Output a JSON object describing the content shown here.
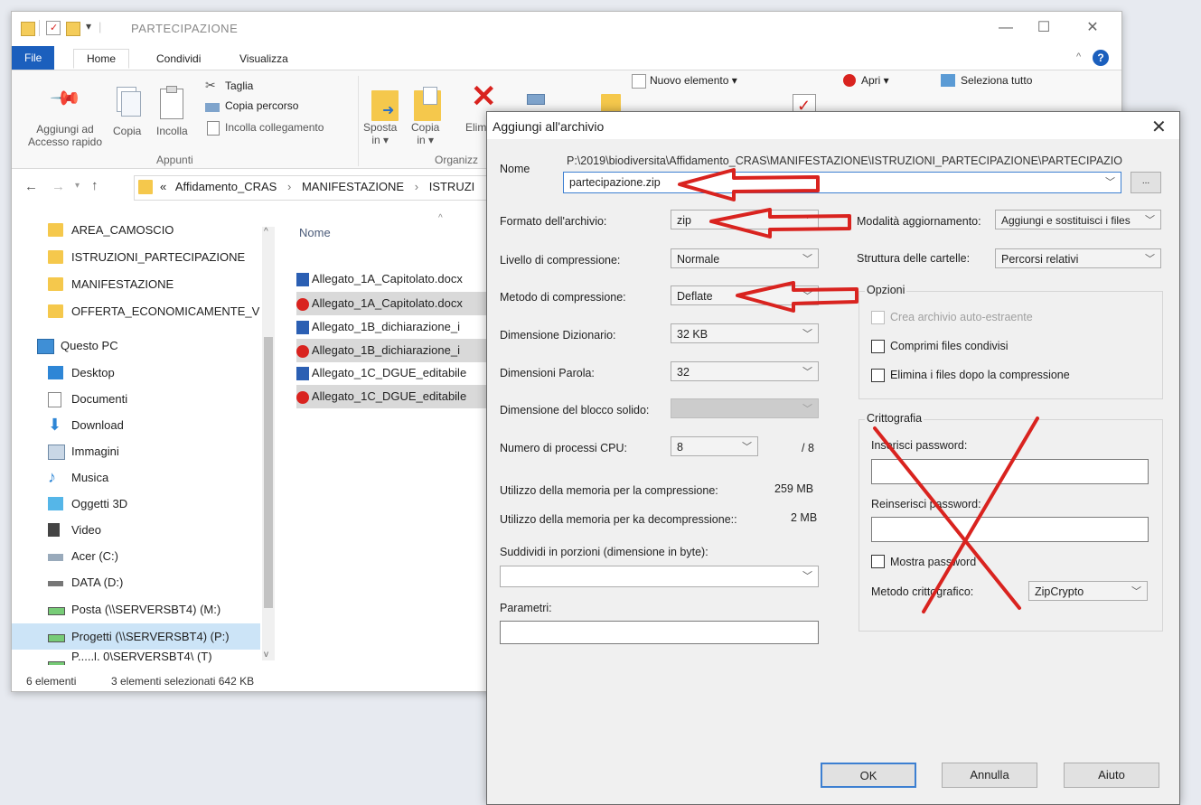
{
  "explorer": {
    "title": "PARTECIPAZIONE",
    "tabs": [
      "File",
      "Home",
      "Condividi",
      "Visualizza"
    ],
    "ribbon": {
      "pin": "Aggiungi ad Accesso rapido",
      "pin_line1": "Aggiungi ad",
      "pin_line2": "Accesso rapido",
      "copy": "Copia",
      "paste": "Incolla",
      "cut": "Taglia",
      "copy_path": "Copia percorso",
      "paste_shortcut": "Incolla collegamento",
      "clipboard_group": "Appunti",
      "move_to": "Sposta",
      "move_to_suffix": "in ▾",
      "copy_to": "Copia",
      "copy_to_suffix": "in ▾",
      "delete": "Elim",
      "organize_group": "Organizz",
      "new_item": "Nuovo elemento ▾",
      "open": "Apri ▾",
      "select_all": "Seleziona tutto"
    },
    "address": {
      "prefix": "«",
      "crumbs": [
        "Affidamento_CRAS",
        "MANIFESTAZIONE",
        "ISTRUZI"
      ],
      "sep": "›"
    },
    "nav_items": [
      {
        "label": "AREA_CAMOSCIO",
        "icon": "folder-icon"
      },
      {
        "label": "ISTRUZIONI_PARTECIPAZIONE",
        "icon": "folder-icon"
      },
      {
        "label": "MANIFESTAZIONE",
        "icon": "folder-icon"
      },
      {
        "label": "OFFERTA_ECONOMICAMENTE_V",
        "icon": "folder-icon"
      },
      {
        "label": "Questo PC",
        "icon": "pc-icon"
      },
      {
        "label": "Desktop",
        "icon": "desktop-icon"
      },
      {
        "label": "Documenti",
        "icon": "documents-icon"
      },
      {
        "label": "Download",
        "icon": "download-icon"
      },
      {
        "label": "Immagini",
        "icon": "pictures-icon"
      },
      {
        "label": "Musica",
        "icon": "music-icon"
      },
      {
        "label": "Oggetti 3D",
        "icon": "objects-3d-icon"
      },
      {
        "label": "Video",
        "icon": "video-icon"
      },
      {
        "label": "Acer (C:)",
        "icon": "drive-icon"
      },
      {
        "label": "DATA (D:)",
        "icon": "drive-icon"
      },
      {
        "label": "Posta (\\\\SERVERSBT4) (M:)",
        "icon": "network-drive-icon"
      },
      {
        "label": "Progetti (\\\\SERVERSBT4) (P:)",
        "icon": "network-drive-icon"
      },
      {
        "label": "P.....l. 0\\SERVERSBT4\\ (T)",
        "icon": "network-drive-icon"
      }
    ],
    "column_header": "Nome",
    "files": [
      {
        "name": "Allegato_1A_Capitolato.docx",
        "type": "word"
      },
      {
        "name": "Allegato_1A_Capitolato.docx",
        "type": "pdf"
      },
      {
        "name": "Allegato_1B_dichiarazione_i",
        "type": "word"
      },
      {
        "name": "Allegato_1B_dichiarazione_i",
        "type": "pdf"
      },
      {
        "name": "Allegato_1C_DGUE_editabile",
        "type": "word"
      },
      {
        "name": "Allegato_1C_DGUE_editabile",
        "type": "pdf"
      }
    ],
    "status": {
      "count": "6 elementi",
      "selected": "3 elementi selezionati  642 KB"
    }
  },
  "dialog": {
    "title": "Aggiungi all'archivio",
    "name_label": "Nome",
    "path": "P:\\2019\\biodiversita\\Affidamento_CRAS\\MANIFESTAZIONE\\ISTRUZIONI_PARTECIPAZIONE\\PARTECIPAZIO",
    "filename": "partecipazione.zip",
    "browse": "...",
    "format_label": "Formato dell'archivio:",
    "format_value": "zip",
    "level_label": "Livello di compressione:",
    "level_value": "Normale",
    "method_label": "Metodo di compressione:",
    "method_value": "Deflate",
    "dict_label": "Dimensione Dizionario:",
    "dict_value": "32 KB",
    "word_label": "Dimensioni Parola:",
    "word_value": "32",
    "solid_label": "Dimensione del blocco solido:",
    "cpu_label": "Numero di processi CPU:",
    "cpu_value": "8",
    "cpu_total": "/ 8",
    "mem_comp_label": "Utilizzo della memoria per la compressione:",
    "mem_comp_value": "259 MB",
    "mem_decomp_label": "Utilizzo della memoria per ka decompressione::",
    "mem_decomp_value": "2 MB",
    "split_label": "Suddividi in porzioni (dimensione in byte):",
    "params_label": "Parametri:",
    "update_label": "Modalità aggiornamento:",
    "update_value": "Aggiungi e sostituisci i files",
    "paths_label": "Struttura delle cartelle:",
    "paths_value": "Percorsi relativi",
    "options_legend": "Opzioni",
    "opt_sfx": "Crea archivio auto-estraente",
    "opt_shared": "Comprimi files condivisi",
    "opt_delete": "Elimina i files dopo la compressione",
    "crypto_legend": "Crittografia",
    "pwd_label": "Inserisci password:",
    "pwd2_label": "Reinserisci password:",
    "show_pwd": "Mostra password",
    "enc_label": "Metodo crittografico:",
    "enc_value": "ZipCrypto",
    "ok": "OK",
    "cancel": "Annulla",
    "help": "Aiuto"
  },
  "colors": {
    "annotation": "#d9231f",
    "file_tab": "#1b5fbd"
  }
}
